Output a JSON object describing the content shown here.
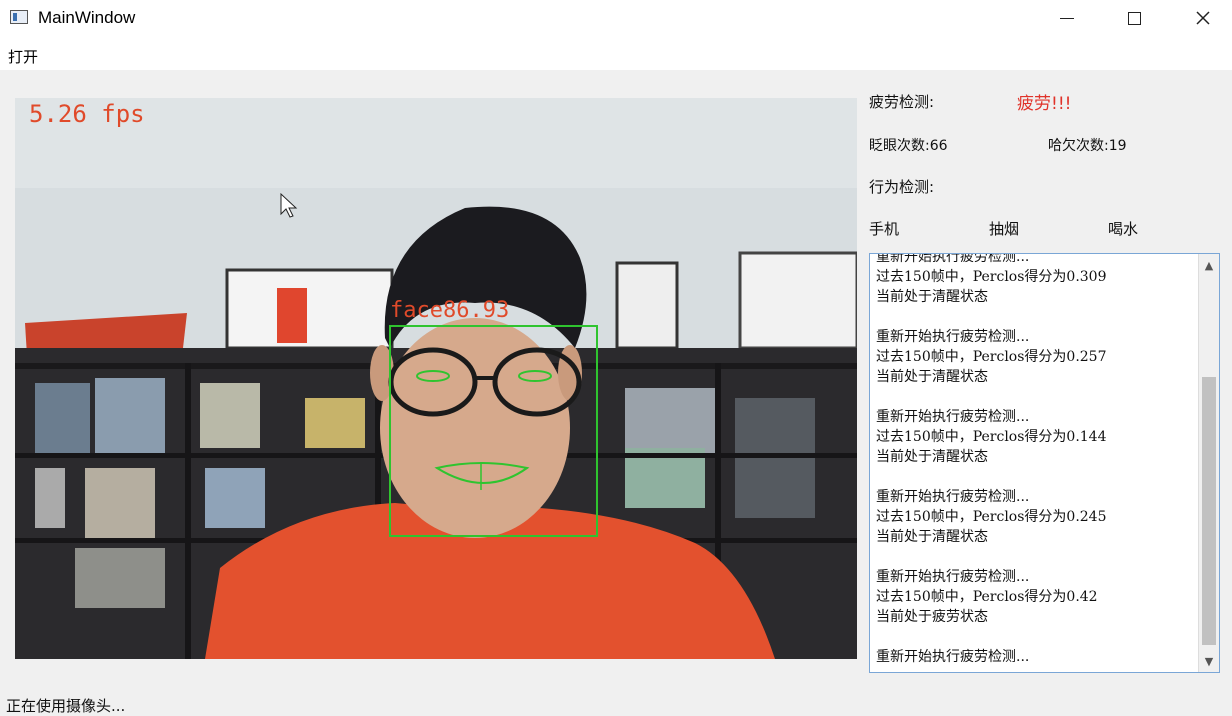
{
  "window": {
    "title": "MainWindow"
  },
  "menu": {
    "items": [
      "打开"
    ]
  },
  "video": {
    "fps_text": "5.26 fps",
    "face_label": "face86.93"
  },
  "panel": {
    "fatigue_label": "疲劳检测:",
    "fatigue_value": "疲劳!!!",
    "blink_label": "眨眼次数:66",
    "yawn_label": "哈欠次数:19",
    "behavior_label": "行为检测:",
    "behaviors": [
      "手机",
      "抽烟",
      "喝水"
    ]
  },
  "log": {
    "lines": [
      "重新开始执行疲劳检测...",
      "过去150帧中，Perclos得分为0.309",
      "当前处于清醒状态",
      "",
      "重新开始执行疲劳检测...",
      "过去150帧中，Perclos得分为0.257",
      "当前处于清醒状态",
      "",
      "重新开始执行疲劳检测...",
      "过去150帧中，Perclos得分为0.144",
      "当前处于清醒状态",
      "",
      "重新开始执行疲劳检测...",
      "过去150帧中，Perclos得分为0.245",
      "当前处于清醒状态",
      "",
      "重新开始执行疲劳检测...",
      "过去150帧中，Perclos得分为0.42",
      "当前处于疲劳状态",
      "",
      "重新开始执行疲劳检测..."
    ]
  },
  "statusbar": {
    "text": "正在使用摄像头..."
  },
  "colors": {
    "alert_red": "#e0332a",
    "overlay_green": "#2fc42f",
    "fps_red": "#e04a2a"
  }
}
